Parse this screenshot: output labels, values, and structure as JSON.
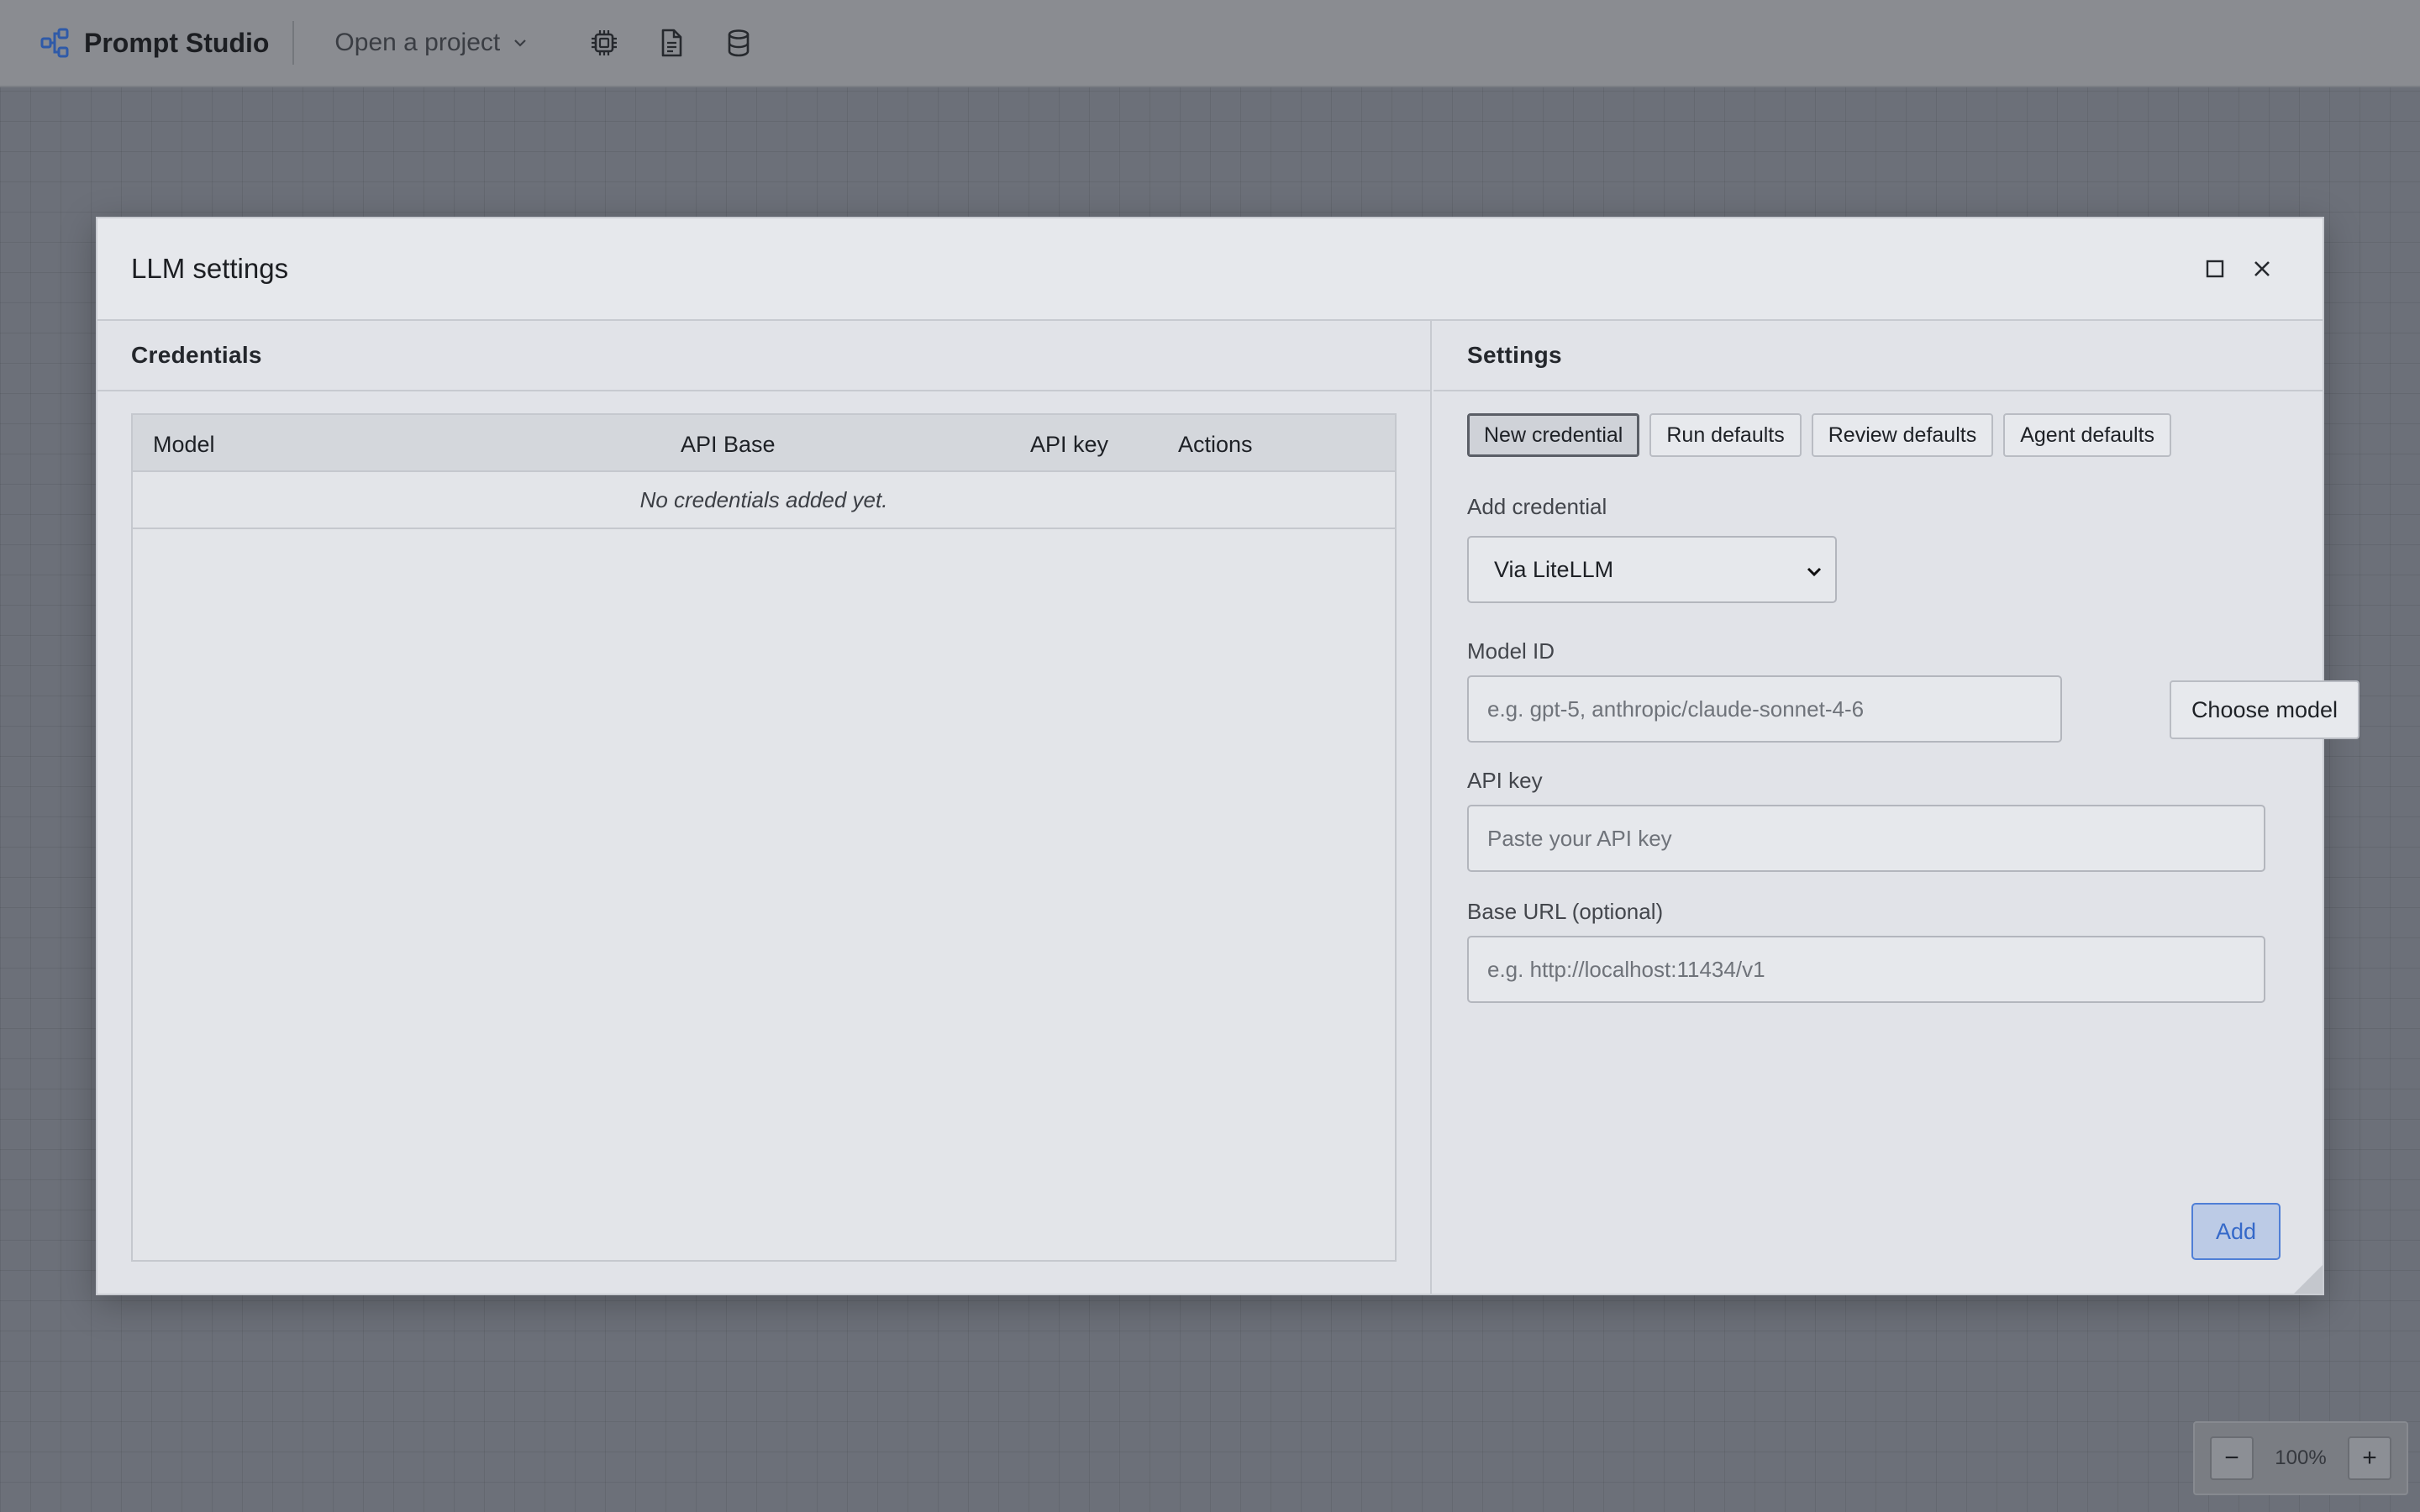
{
  "app": {
    "title": "Prompt Studio",
    "project_menu_label": "Open a project",
    "toolbar_icons": [
      "chip-icon",
      "document-icon",
      "database-icon"
    ]
  },
  "dialog": {
    "title": "LLM settings",
    "credentials": {
      "heading": "Credentials",
      "columns": [
        "Model",
        "API Base",
        "API key",
        "Actions"
      ],
      "empty_text": "No credentials added yet."
    },
    "settings": {
      "heading": "Settings",
      "tabs": [
        {
          "label": "New credential",
          "active": true
        },
        {
          "label": "Run defaults",
          "active": false
        },
        {
          "label": "Review defaults",
          "active": false
        },
        {
          "label": "Agent defaults",
          "active": false
        }
      ],
      "add_credential_label": "Add credential",
      "add_credential_selected": "Via LiteLLM",
      "model_id_label": "Model ID",
      "model_id_placeholder": "e.g. gpt-5, anthropic/claude-sonnet-4-6",
      "choose_model_label": "Choose model",
      "api_key_label": "API key",
      "api_key_placeholder": "Paste your API key",
      "base_url_label": "Base URL (optional)",
      "base_url_placeholder": "e.g. http://localhost:11434/v1",
      "add_button_label": "Add"
    }
  },
  "zoom": {
    "minus": "−",
    "value": "100%",
    "plus": "+"
  },
  "colors": {
    "accent": "#3569c9",
    "brand_icon": "#2f5aa8"
  }
}
